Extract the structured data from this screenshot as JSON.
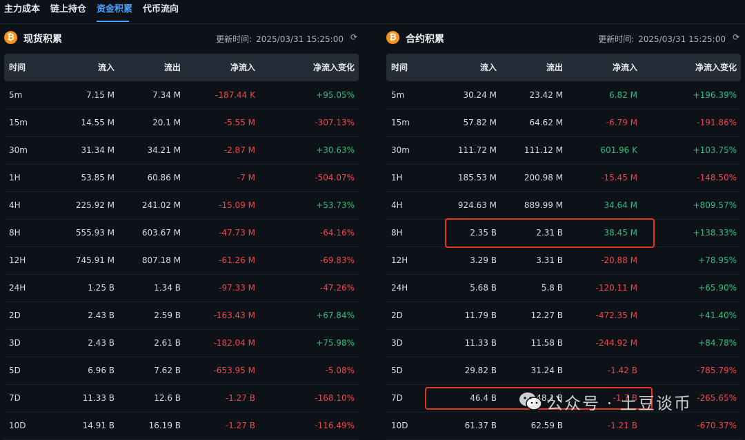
{
  "tabs": [
    {
      "label": "主力成本",
      "active": false
    },
    {
      "label": "链上持仓",
      "active": false
    },
    {
      "label": "资金积累",
      "active": true
    },
    {
      "label": "代币流向",
      "active": false
    }
  ],
  "colors": {
    "background": "#0d1219",
    "accent": "#4aa3ff",
    "negative": "#f0454b",
    "positive": "#2ebd7d",
    "btc": "#f7931a",
    "highlight": "#e8361e"
  },
  "spot": {
    "title": "现货积累",
    "update_label": "更新时间:",
    "update_time": "2025/03/31 15:25:00",
    "headers": [
      "时间",
      "流入",
      "流出",
      "净流入",
      "净流入变化"
    ],
    "rows": [
      [
        "5m",
        "7.15 M",
        "7.34 M",
        "-187.44 K",
        "+95.05%"
      ],
      [
        "15m",
        "14.55 M",
        "20.1 M",
        "-5.55 M",
        "-307.13%"
      ],
      [
        "30m",
        "31.34 M",
        "34.21 M",
        "-2.87 M",
        "+30.63%"
      ],
      [
        "1H",
        "53.85 M",
        "60.86 M",
        "-7 M",
        "-504.07%"
      ],
      [
        "4H",
        "225.92 M",
        "241.02 M",
        "-15.09 M",
        "+53.73%"
      ],
      [
        "8H",
        "555.93 M",
        "603.67 M",
        "-47.73 M",
        "-64.16%"
      ],
      [
        "12H",
        "745.91 M",
        "807.18 M",
        "-61.26 M",
        "-69.83%"
      ],
      [
        "24H",
        "1.25 B",
        "1.34 B",
        "-97.33 M",
        "-47.26%"
      ],
      [
        "2D",
        "2.43 B",
        "2.59 B",
        "-163.43 M",
        "+67.84%"
      ],
      [
        "3D",
        "2.43 B",
        "2.61 B",
        "-182.04 M",
        "+75.98%"
      ],
      [
        "5D",
        "6.96 B",
        "7.62 B",
        "-653.95 M",
        "-5.08%"
      ],
      [
        "7D",
        "11.33 B",
        "12.6 B",
        "-1.27 B",
        "-168.10%"
      ],
      [
        "10D",
        "14.91 B",
        "16.19 B",
        "-1.27 B",
        "-116.49%"
      ]
    ]
  },
  "futures": {
    "title": "合约积累",
    "update_label": "更新时间:",
    "update_time": "2025/03/31 15:25:00",
    "headers": [
      "时间",
      "流入",
      "流出",
      "净流入",
      "净流入变化"
    ],
    "rows": [
      [
        "5m",
        "30.24 M",
        "23.42 M",
        "6.82 M",
        "+196.39%"
      ],
      [
        "15m",
        "57.82 M",
        "64.62 M",
        "-6.79 M",
        "-191.86%"
      ],
      [
        "30m",
        "111.72 M",
        "111.12 M",
        "601.96 K",
        "+103.75%"
      ],
      [
        "1H",
        "185.53 M",
        "200.98 M",
        "-15.45 M",
        "-148.50%"
      ],
      [
        "4H",
        "924.63 M",
        "889.99 M",
        "34.64 M",
        "+809.57%"
      ],
      [
        "8H",
        "2.35 B",
        "2.31 B",
        "38.45 M",
        "+138.33%"
      ],
      [
        "12H",
        "3.29 B",
        "3.31 B",
        "-20.88 M",
        "+78.95%"
      ],
      [
        "24H",
        "5.68 B",
        "5.8 B",
        "-120.11 M",
        "+65.90%"
      ],
      [
        "2D",
        "11.79 B",
        "12.27 B",
        "-472.35 M",
        "+41.40%"
      ],
      [
        "3D",
        "11.33 B",
        "11.58 B",
        "-244.92 M",
        "+84.78%"
      ],
      [
        "5D",
        "29.82 B",
        "31.24 B",
        "-1.42 B",
        "-785.79%"
      ],
      [
        "7D",
        "46.4 B",
        "48.1 B",
        "-1.7 B",
        "-265.65%"
      ],
      [
        "10D",
        "61.37 B",
        "62.59 B",
        "-1.21 B",
        "-670.37%"
      ]
    ]
  },
  "watermark": "公众号 · 土豆谈币"
}
